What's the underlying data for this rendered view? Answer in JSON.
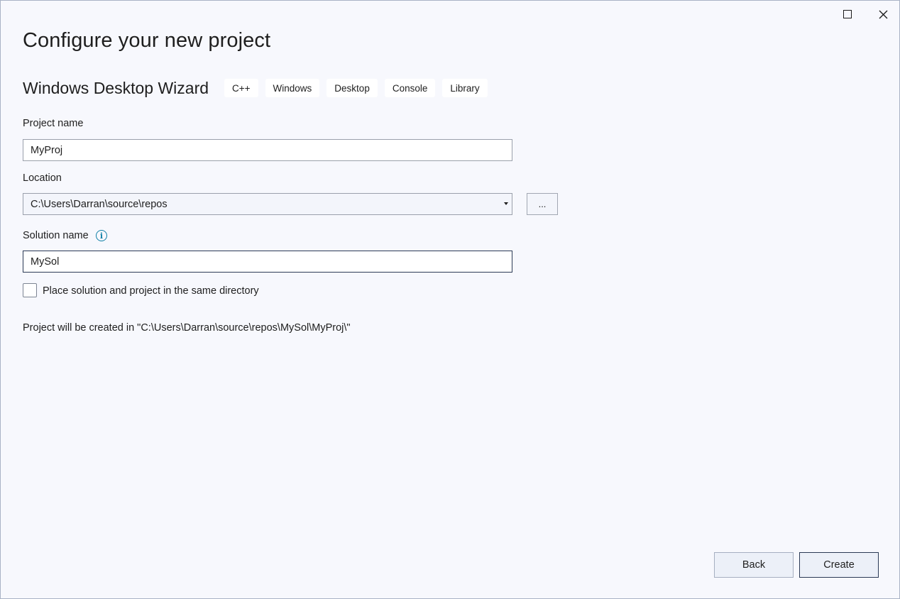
{
  "window": {
    "maximize_icon": "maximize-icon",
    "close_icon": "close-icon"
  },
  "page": {
    "title": "Configure your new project"
  },
  "template": {
    "name": "Windows Desktop Wizard",
    "tags": [
      "C++",
      "Windows",
      "Desktop",
      "Console",
      "Library"
    ]
  },
  "form": {
    "project_name_label": "Project name",
    "project_name_value": "MyProj",
    "location_label": "Location",
    "location_value": "C:\\Users\\Darran\\source\\repos",
    "browse_label": "...",
    "solution_name_label": "Solution name",
    "solution_name_value": "MySol",
    "same_directory_label": "Place solution and project in the same directory",
    "same_directory_checked": false
  },
  "status": {
    "created_path_text": "Project will be created in \"C:\\Users\\Darran\\source\\repos\\MySol\\MyProj\\\""
  },
  "footer": {
    "back_label": "Back",
    "create_label": "Create"
  },
  "colors": {
    "window_bg": "#f7f8fd",
    "info_accent": "#0e7fa6",
    "focus_border": "#2b3a55"
  }
}
